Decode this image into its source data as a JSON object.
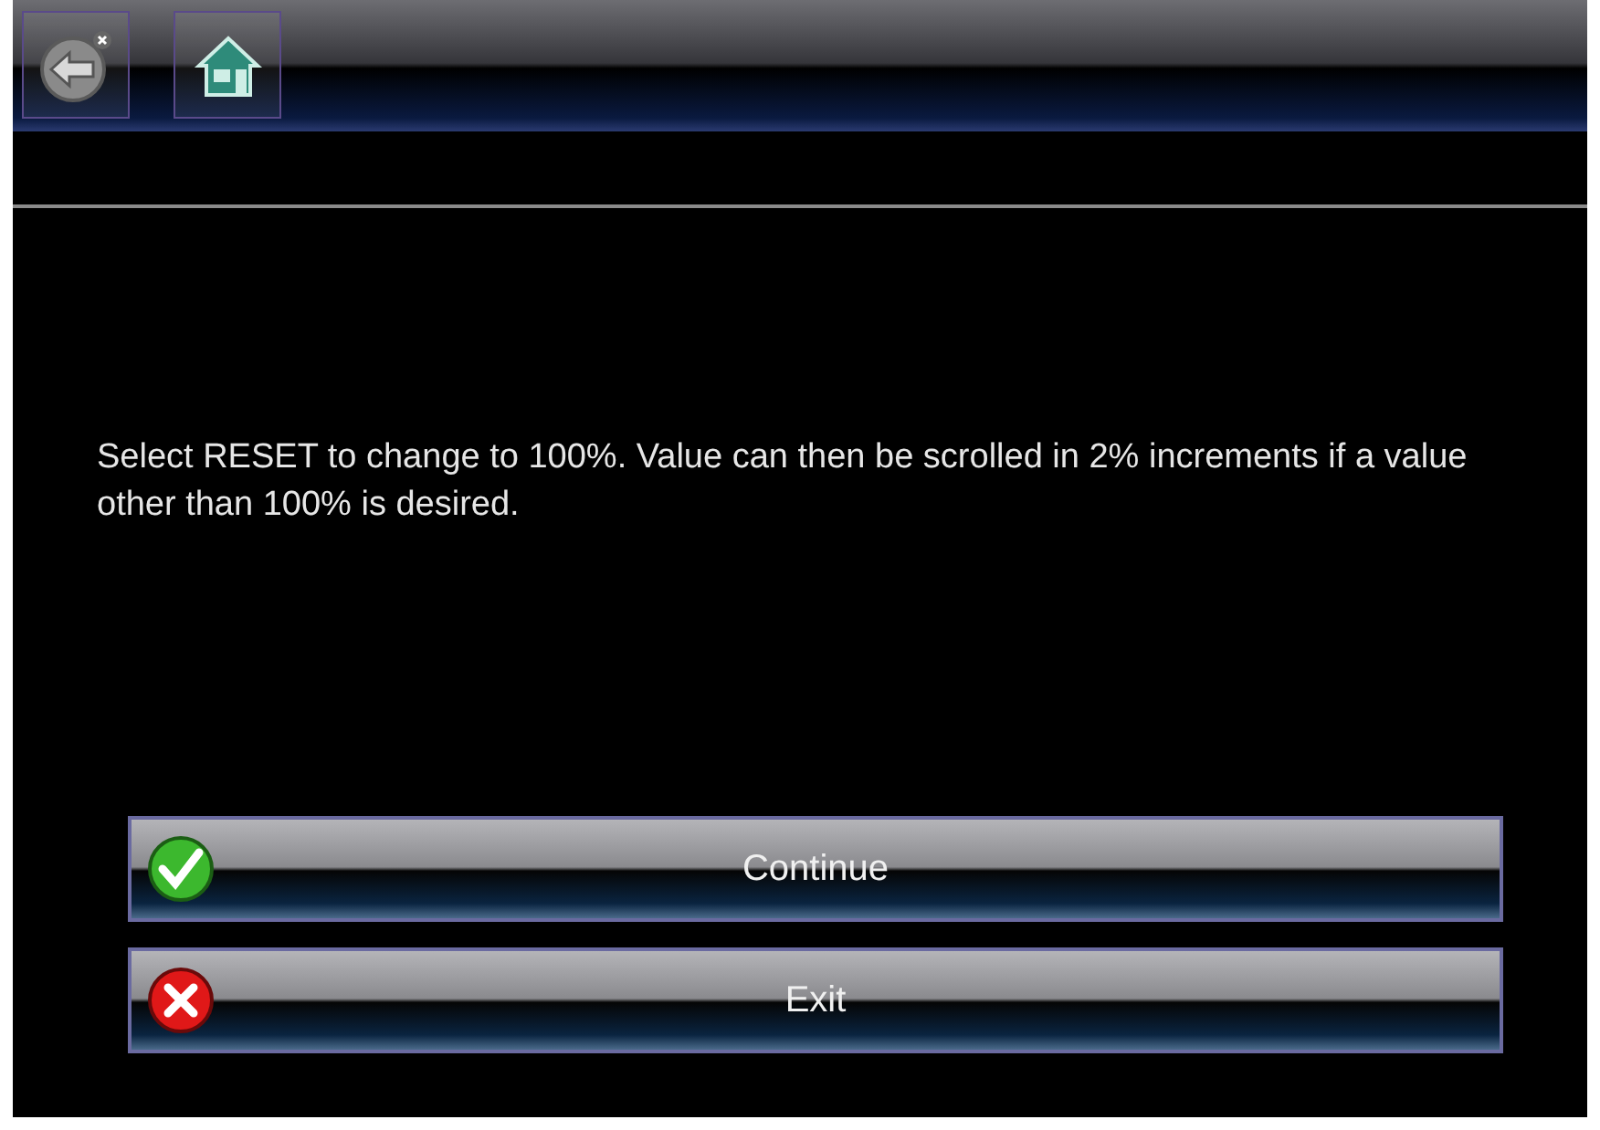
{
  "toolbar": {
    "buttons": [
      {
        "kind": "back"
      },
      {
        "kind": "home"
      }
    ]
  },
  "message": "Select RESET to change to 100%. Value can then be scrolled in 2% increments if a value other than 100% is desired.",
  "actions": [
    {
      "kind": "confirm",
      "label": "Continue"
    },
    {
      "kind": "cancel",
      "label": "Exit"
    }
  ]
}
